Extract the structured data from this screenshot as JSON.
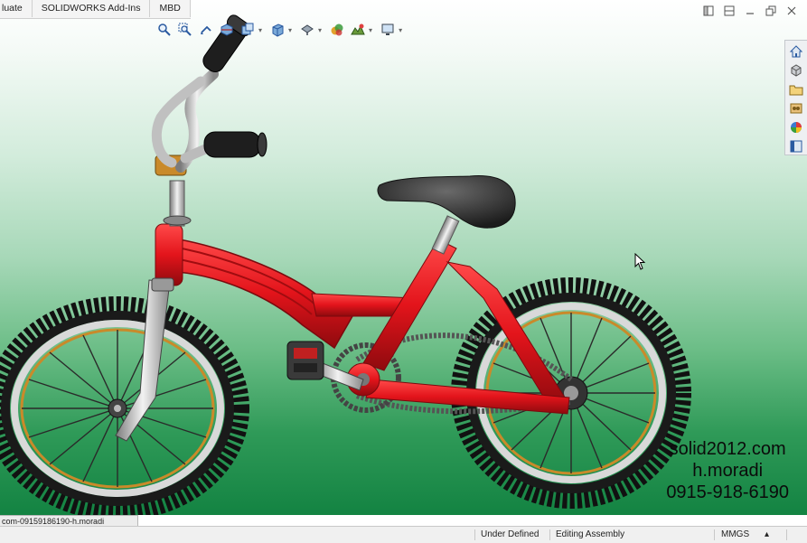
{
  "tabs": [
    "luate",
    "SOLIDWORKS Add-Ins",
    "MBD"
  ],
  "hud_icons": [
    "zoom-to-fit-icon",
    "zoom-area-icon",
    "previous-view-icon",
    "section-view-icon",
    "dynamic-annotation-icon",
    "view-orientation-icon",
    "display-style-icon",
    "hide-show-items-icon",
    "edit-appearance-icon",
    "apply-scene-icon",
    "view-settings-icon"
  ],
  "taskpane_icons": [
    "home-icon",
    "parts-library-icon",
    "file-explorer-icon",
    "view-palette-icon",
    "appearances-icon",
    "custom-properties-icon"
  ],
  "watermark": {
    "line1": "solid2012.com",
    "line2": "h.moradi",
    "line3": "0915-918-6190"
  },
  "doc_tab": "com-09159186190-h.moradi",
  "status": {
    "state": "Under Defined",
    "mode": "Editing Assembly",
    "units": "MMGS",
    "caret": "▴"
  },
  "colors": {
    "frame": "#e3141b",
    "tire": "#141414",
    "rim": "#d9d9d9",
    "rim_accent": "#c98a2a",
    "seat": "#2a2a2a"
  }
}
